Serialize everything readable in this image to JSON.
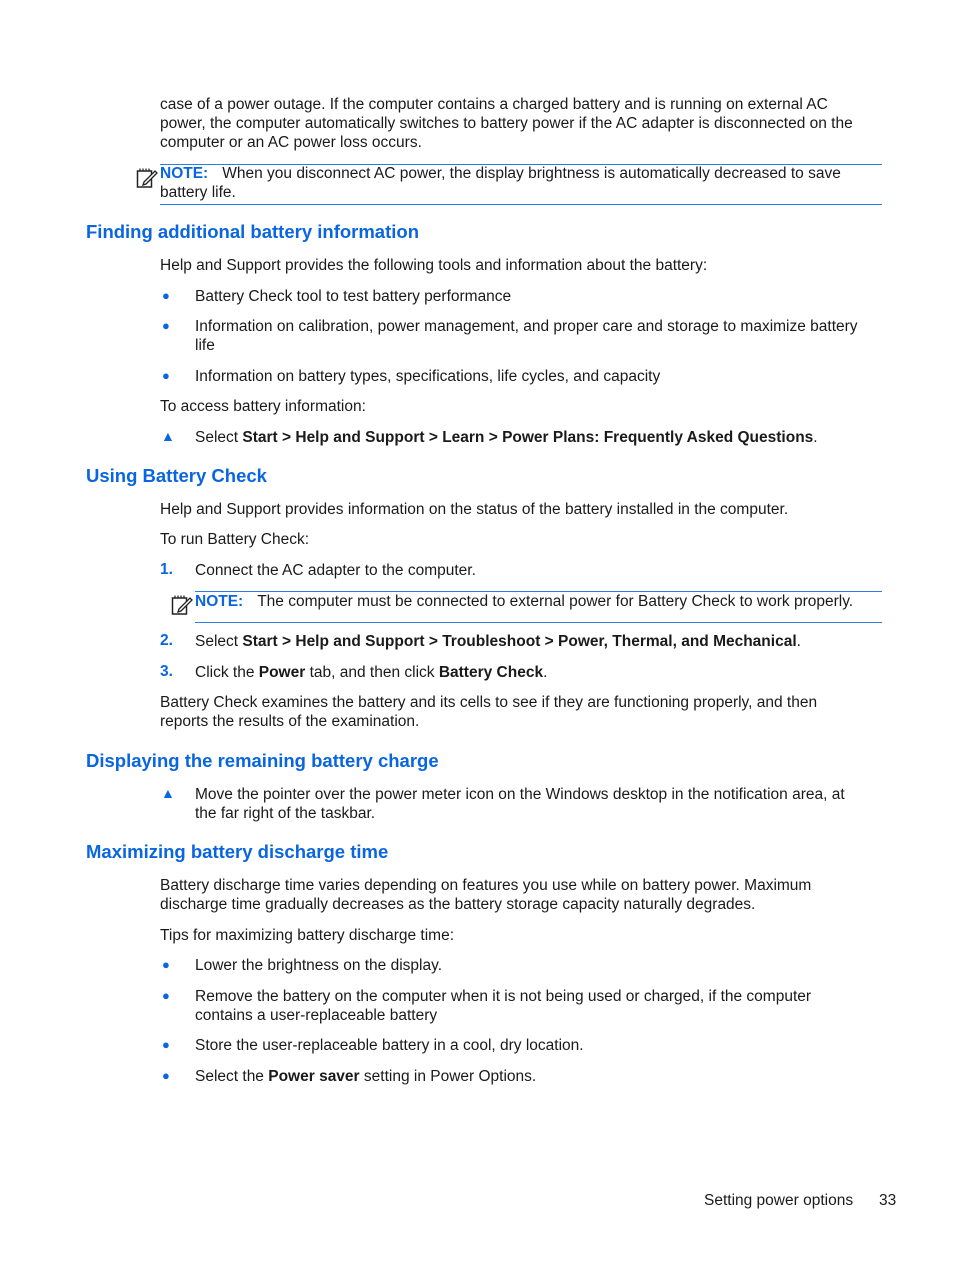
{
  "intro": {
    "lines": [
      "case of a power outage. If the computer contains a charged battery and is running on external AC",
      "power, the computer automatically switches to battery power if the AC adapter is disconnected on the",
      "computer or an AC power loss occurs."
    ]
  },
  "note1": {
    "label": "NOTE:",
    "text_line1": "When you disconnect AC power, the display brightness is automatically decreased to save",
    "text_line2": "battery life."
  },
  "section1": {
    "heading": "Finding additional battery information",
    "intro": "Help and Support provides the following tools and information about the battery:",
    "bullets": [
      "Battery Check tool to test battery performance",
      "Information on calibration, power management, and proper care and storage to maximize battery",
      "life",
      "Information on battery types, specifications, life cycles, and capacity"
    ],
    "access_label": "To access battery information:",
    "step": {
      "prefix": "Select ",
      "path": "Start > Help and Support > Learn > Power Plans: Frequently Asked Questions",
      "suffix": "."
    }
  },
  "section2": {
    "heading": "Using Battery Check",
    "intro": "Help and Support provides information on the status of the battery installed in the computer.",
    "run_label": "To run Battery Check:",
    "steps": [
      {
        "num": "1.",
        "text": "Connect the AC adapter to the computer."
      },
      {
        "num": "2.",
        "prefix": "Select ",
        "bold": "Start > Help and Support > Troubleshoot > Power, Thermal, and Mechanical",
        "suffix": "."
      },
      {
        "num": "3.",
        "prefix": "Click the ",
        "bold1": "Power",
        "mid": " tab, and then click ",
        "bold2": "Battery Check",
        "suffix": "."
      }
    ],
    "note": {
      "label": "NOTE:",
      "text": "The computer must be connected to external power for Battery Check to work properly."
    },
    "outro_line1": "Battery Check examines the battery and its cells to see if they are functioning properly, and then",
    "outro_line2": "reports the results of the examination."
  },
  "section3": {
    "heading": "Displaying the remaining battery charge",
    "step_line1": "Move the pointer over the power meter icon on the Windows desktop in the notification area, at",
    "step_line2": "the far right of the taskbar."
  },
  "section4": {
    "heading": "Maximizing battery discharge time",
    "intro_line1": "Battery discharge time varies depending on features you use while on battery power. Maximum",
    "intro_line2": "discharge time gradually decreases as the battery storage capacity naturally degrades.",
    "tips_label": "Tips for maximizing battery discharge time:",
    "bullets": [
      "Lower the brightness on the display.",
      "Remove the battery on the computer when it is not being used or charged, if the computer",
      "contains a user-replaceable battery",
      "Store the user-replaceable battery in a cool, dry location."
    ],
    "last_bullet": {
      "prefix": "Select the ",
      "bold": "Power saver",
      "suffix": " setting in Power Options."
    }
  },
  "footer": {
    "section_title": "Setting power options",
    "page_number": "33"
  },
  "glyphs": {
    "bullet": "●",
    "triangle": "▲"
  },
  "colors": {
    "accent": "#0a66e0",
    "rule": "#2a7de8",
    "text": "#1a1a1a"
  }
}
